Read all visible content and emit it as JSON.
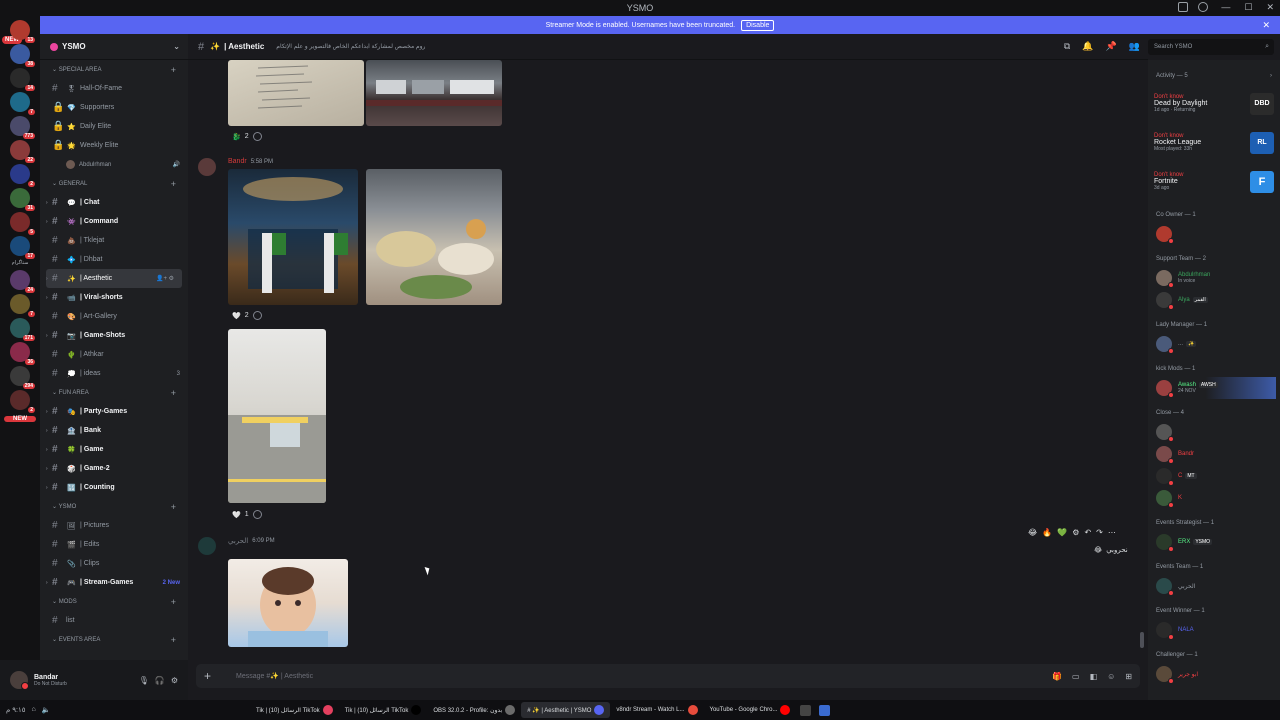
{
  "window": {
    "title": "YSMO"
  },
  "banner": {
    "text": "Streamer Mode is enabled. Usernames have been truncated.",
    "disable_label": "Disable"
  },
  "rail": {
    "new_label": "NEW",
    "new_label_bottom": "NEW",
    "badges": [
      "13",
      "38",
      "14",
      "7",
      "773",
      "22",
      "2",
      "31",
      "5",
      "17",
      "24",
      "7",
      "171",
      "36",
      "294",
      "2"
    ],
    "text_tag": "ستاگرام"
  },
  "server": {
    "name": "YSMO"
  },
  "categories": [
    {
      "name": "SPECIAL AREA",
      "channels": [
        {
          "emoji": "🎖",
          "label": "Hall-Of-Fame",
          "locked": false
        },
        {
          "emoji": "💎",
          "label": "Supporters",
          "locked": true
        },
        {
          "emoji": "⭐",
          "label": "Daily Elite",
          "locked": true
        },
        {
          "emoji": "🌟",
          "label": "Weekly Elite",
          "locked": true
        }
      ],
      "voice_user": "Abdulrhman"
    },
    {
      "name": "GENERAL",
      "channels": [
        {
          "emoji": "💬",
          "label": "| Chat",
          "unread": true
        },
        {
          "emoji": "👾",
          "label": "| Command",
          "unread": true
        },
        {
          "emoji": "💩",
          "label": "| Tklejat"
        },
        {
          "emoji": "💠",
          "label": "| Dhbat"
        },
        {
          "emoji": "✨",
          "label": "| Aesthetic",
          "active": true
        },
        {
          "emoji": "📹",
          "label": "| Viral-shorts",
          "unread": true
        },
        {
          "emoji": "🎨",
          "label": "| Art-Gallery"
        },
        {
          "emoji": "📷",
          "label": "| Game-Shots",
          "unread": true
        },
        {
          "emoji": "🌵",
          "label": "| Athkar"
        },
        {
          "emoji": "💭",
          "label": "| ideas",
          "count": "3"
        }
      ]
    },
    {
      "name": "FUN AREA",
      "channels": [
        {
          "emoji": "🎭",
          "label": "| Party-Games",
          "unread": true
        },
        {
          "emoji": "🏦",
          "label": "| Bank",
          "unread": true
        },
        {
          "emoji": "🍀",
          "label": "| Game",
          "unread": true
        },
        {
          "emoji": "🎲",
          "label": "| Game-2",
          "unread": true
        },
        {
          "emoji": "🔢",
          "label": "| Counting",
          "unread": true
        }
      ]
    },
    {
      "name": "YSMO",
      "channels": [
        {
          "emoji": "🖼",
          "label": "| Pictures"
        },
        {
          "emoji": "🎬",
          "label": "| Edits"
        },
        {
          "emoji": "📎",
          "label": "| Clips"
        },
        {
          "emoji": "🎮",
          "label": "| Stream-Games",
          "unread": true,
          "new": "2 New"
        }
      ]
    },
    {
      "name": "MODS",
      "channels": [
        {
          "emoji": "",
          "label": "list"
        }
      ]
    },
    {
      "name": "EVENTS AREA",
      "channels": []
    }
  ],
  "user": {
    "name": "Bandar",
    "status": "Do Not Disturb"
  },
  "channel_header": {
    "title": "| Aesthetic",
    "topic": "روم مخصص لمشاركة ابداعكم الخاص فالتصوير و علم الإتكام",
    "search_placeholder": "Search YSMO"
  },
  "messages": [
    {
      "reaction": {
        "emoji": "🐉",
        "count": "2"
      }
    },
    {
      "author": "Bandr",
      "time": "5:58 PM",
      "reaction": {
        "emoji": "🤍",
        "count": "2"
      }
    },
    {
      "reaction": {
        "emoji": "🤍",
        "count": "1"
      }
    },
    {
      "author": "الحربي",
      "time": "6:09 PM",
      "side_emoji": "😂",
      "side_text": "نحروبي"
    }
  ],
  "hover_actions": [
    "😂",
    "🔥",
    "💚",
    "⚙",
    "↶",
    "↷",
    "⋯"
  ],
  "composer": {
    "placeholder": "Message #✨ | Aesthetic"
  },
  "activity": {
    "header": "Activity — 5",
    "items": [
      {
        "who": "Don't know",
        "game": "Dead by Daylight",
        "meta": "1d ago · Returning",
        "icon": "DBD",
        "color": "#2b2b2b"
      },
      {
        "who": "Don't know",
        "game": "Rocket League",
        "meta": "Most played: 33h",
        "icon": "RL",
        "color": "#1d5fb3"
      },
      {
        "who": "Don't know",
        "game": "Fortnite",
        "meta": "3d ago",
        "icon": "F",
        "color": "#2e8ee6"
      }
    ]
  },
  "roles": [
    {
      "name": "Co Owner — 1",
      "members": [
        {
          "name": "",
          "color": "#f23f43",
          "av": "#b03a2e"
        }
      ]
    },
    {
      "name": "Support Team — 2",
      "members": [
        {
          "name": "Abdulrhman",
          "sub": "In voice",
          "color": "#3ba55d",
          "av": "#7a6a60"
        },
        {
          "name": "Alya",
          "tag": "القمر",
          "color": "#3ba55d",
          "av": "#3a3a3a"
        }
      ]
    },
    {
      "name": "Lady Manager — 1",
      "members": [
        {
          "name": "...",
          "tag": "✨",
          "color": "#949ba4",
          "av": "#4a5a7a"
        }
      ]
    },
    {
      "name": "kick Mods — 1",
      "members": [
        {
          "name": "Awash",
          "tag": "AWSH",
          "sub": "24 NOV",
          "color": "#57f287",
          "av": "#9a4040",
          "highlight": true
        }
      ]
    },
    {
      "name": "Close — 4",
      "members": [
        {
          "name": "",
          "color": "#f23f43",
          "av": "#555"
        },
        {
          "name": "Bandr",
          "color": "#f23f43",
          "av": "#7a4a4a"
        },
        {
          "name": "C ",
          "tag": "MT",
          "color": "#f23f43",
          "av": "#2a2a2a"
        },
        {
          "name": "K",
          "color": "#f23f43",
          "av": "#3a5a3a"
        }
      ]
    },
    {
      "name": "Events Strategist — 1",
      "members": [
        {
          "name": "ERX",
          "tag": "YSMO",
          "color": "#57f287",
          "av": "#2a3a2a"
        }
      ]
    },
    {
      "name": "Events Team — 1",
      "members": [
        {
          "name": "الحربي",
          "color": "#949ba4",
          "av": "#2a4a4a"
        }
      ]
    },
    {
      "name": "Event Winner — 1",
      "members": [
        {
          "name": "NALA",
          "color": "#5865f2",
          "av": "#2a2a2a"
        }
      ]
    },
    {
      "name": "Challenger — 1",
      "members": [
        {
          "name": "ابو جرير",
          "color": "#f23f43",
          "av": "#5a4a3a"
        }
      ]
    }
  ],
  "taskbar": {
    "time": "٩:١٥ م",
    "date": "٢٠٢٤/١١/٢٧",
    "items": [
      "Tik | الرسائل (10) TikTok",
      "Tik | الرسائل (10) TikTok",
      "OBS 32.0.2 - Profile: بدون",
      "# ✨ | Aesthetic | YSMO",
      "v8ndr Stream - Watch L...",
      "YouTube - Google Chro..."
    ]
  }
}
